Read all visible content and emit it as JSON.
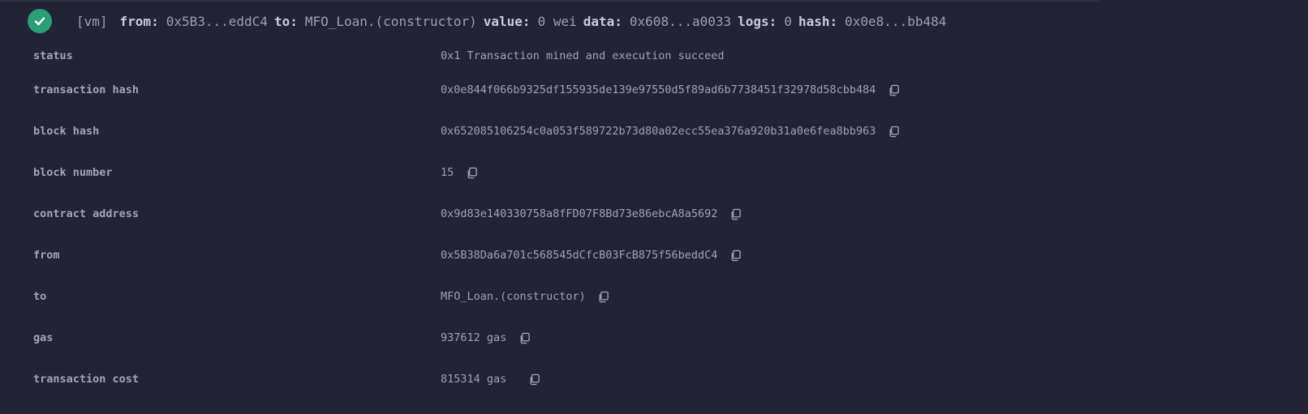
{
  "summary": {
    "tag": "[vm]",
    "from_label": "from:",
    "from_value": "0x5B3...eddC4",
    "to_label": "to:",
    "to_value": "MFO_Loan.(constructor)",
    "value_label": "value:",
    "value_value": "0 wei",
    "data_label": "data:",
    "data_value": "0x608...a0033",
    "logs_label": "logs:",
    "logs_value": "0",
    "hash_label": "hash:",
    "hash_value": "0x0e8...bb484",
    "status_color": "#2aa077"
  },
  "rows": [
    {
      "label": "status",
      "value": "0x1 Transaction mined and execution succeed"
    },
    {
      "label": "transaction hash",
      "value": "0x0e844f066b9325df155935de139e97550d5f89ad6b7738451f32978d58cbb484"
    },
    {
      "label": "block hash",
      "value": "0x652085106254c0a053f589722b73d80a02ecc55ea376a920b31a0e6fea8bb963"
    },
    {
      "label": "block number",
      "value": "15"
    },
    {
      "label": "contract address",
      "value": "0x9d83e140330758a8fFD07F8Bd73e86ebcA8a5692"
    },
    {
      "label": "from",
      "value": "0x5B38Da6a701c568545dCfcB03FcB875f56beddC4"
    },
    {
      "label": "to",
      "value": "MFO_Loan.(constructor)"
    },
    {
      "label": "gas",
      "value": "937612 gas"
    },
    {
      "label": "transaction cost",
      "value": "815314 gas"
    }
  ]
}
